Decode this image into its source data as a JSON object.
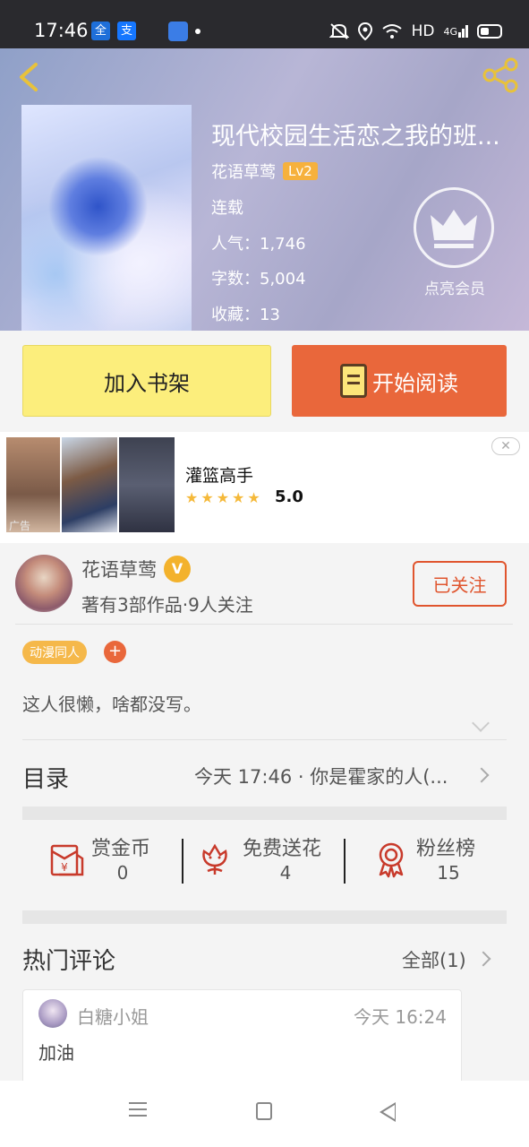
{
  "status_bar": {
    "time": "17:46",
    "app1": "全",
    "app2": "支",
    "network": "HD",
    "signal": "4G"
  },
  "book": {
    "title": "现代校园生活恋之我的班...",
    "author": "花语草莺",
    "level": "Lv2",
    "status": "连载",
    "popularity": "人气：1,746",
    "word_count": "字数：5,004",
    "favorites": "收藏：13",
    "vip_label": "点亮会员"
  },
  "buttons": {
    "add_shelf": "加入书架",
    "start_reading": "开始阅读"
  },
  "ad": {
    "title": "灌篮高手",
    "rating": "5.0",
    "stars": "★★★★★",
    "tag": "广告",
    "close": "✕"
  },
  "author_info": {
    "name": "花语草莺",
    "badge": "V",
    "stats": "著有3部作品·9人关注",
    "follow_label": "已关注",
    "tag": "动漫同人",
    "tag_add": "+",
    "bio": "这人很懒，啥都没写。"
  },
  "toc": {
    "label": "目录",
    "latest": "今天 17:46 · 你是霍家的人(..."
  },
  "actions": [
    {
      "label": "赏金币",
      "count": "0"
    },
    {
      "label": "免费送花",
      "count": "4"
    },
    {
      "label": "粉丝榜",
      "count": "15"
    }
  ],
  "comments_section": {
    "title": "热门评论",
    "all_label": "全部(1)"
  },
  "comments": [
    {
      "user": "白糖小姐",
      "time": "今天 16:24",
      "text": "加油"
    }
  ],
  "colors": {
    "accent_orange": "#e9673b",
    "shelf_yellow": "#fcee7c",
    "badge_gold": "#f3b22c"
  }
}
